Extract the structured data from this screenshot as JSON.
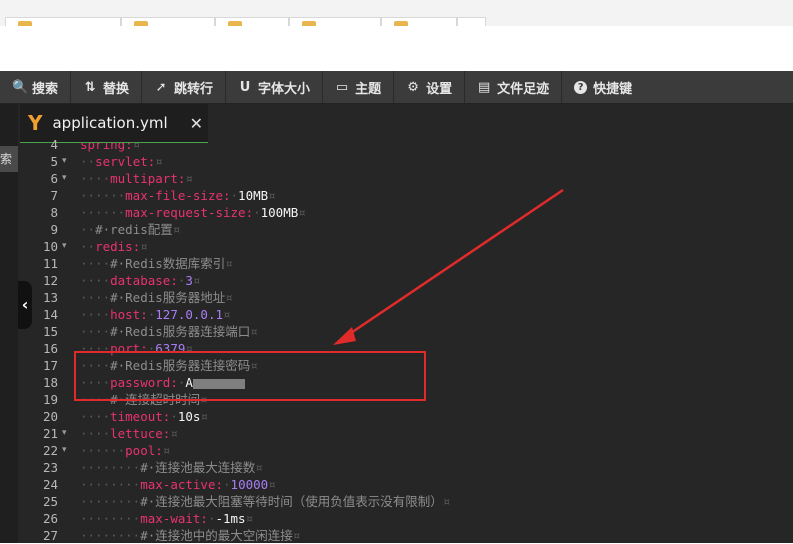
{
  "toolbar": {
    "items": [
      {
        "icon": "search-icon",
        "glyph": "🔍",
        "label": "搜索"
      },
      {
        "icon": "replace-icon",
        "glyph": "⇅",
        "label": "替换"
      },
      {
        "icon": "goto-line-icon",
        "glyph": "➚",
        "label": "跳转行"
      },
      {
        "icon": "font-size-icon",
        "glyph": "U",
        "label": "字体大小"
      },
      {
        "icon": "theme-icon",
        "glyph": "▭",
        "label": "主题"
      },
      {
        "icon": "settings-icon",
        "glyph": "⚙",
        "label": "设置"
      },
      {
        "icon": "history-icon",
        "glyph": "▤",
        "label": "文件足迹"
      },
      {
        "icon": "help-icon",
        "glyph": "?",
        "label": "快捷键"
      }
    ]
  },
  "sidebar": {
    "search_tab_label": "索"
  },
  "editor": {
    "file_tab": {
      "logo": "Y",
      "name": "application.yml",
      "close": "✕"
    },
    "collapse_glyph": "‹",
    "lines": [
      {
        "n": "4",
        "fold": false,
        "text": "spring:¤"
      },
      {
        "n": "5",
        "fold": true,
        "text": "··servlet:¤"
      },
      {
        "n": "6",
        "fold": true,
        "text": "····multipart:¤"
      },
      {
        "n": "7",
        "fold": false,
        "text": "······max-file-size:·10MB¤"
      },
      {
        "n": "8",
        "fold": false,
        "text": "······max-request-size:·100MB¤"
      },
      {
        "n": "9",
        "fold": false,
        "text": "··#·redis配置¤"
      },
      {
        "n": "10",
        "fold": true,
        "text": "··redis:¤"
      },
      {
        "n": "11",
        "fold": false,
        "text": "····#·Redis数据库索引¤"
      },
      {
        "n": "12",
        "fold": false,
        "text": "····database:·3¤"
      },
      {
        "n": "13",
        "fold": false,
        "text": "····#·Redis服务器地址¤"
      },
      {
        "n": "14",
        "fold": false,
        "text": "····host:·127.0.0.1¤"
      },
      {
        "n": "15",
        "fold": false,
        "text": "····#·Redis服务器连接端口¤"
      },
      {
        "n": "16",
        "fold": false,
        "text": "····port:·6379¤"
      },
      {
        "n": "17",
        "fold": false,
        "text": "····#·Redis服务器连接密码¤"
      },
      {
        "n": "18",
        "fold": false,
        "text": "····password:·A"
      },
      {
        "n": "19",
        "fold": false,
        "text": "····#·连接超时时间¤"
      },
      {
        "n": "20",
        "fold": false,
        "text": "····timeout:·10s¤"
      },
      {
        "n": "21",
        "fold": true,
        "text": "····lettuce:¤"
      },
      {
        "n": "22",
        "fold": true,
        "text": "······pool:¤"
      },
      {
        "n": "23",
        "fold": false,
        "text": "········#·连接池最大连接数¤"
      },
      {
        "n": "24",
        "fold": false,
        "text": "········max-active:·10000¤"
      },
      {
        "n": "25",
        "fold": false,
        "text": "········#·连接池最大阻塞等待时间（使用负值表示没有限制）¤"
      },
      {
        "n": "26",
        "fold": false,
        "text": "········max-wait:·-1ms¤"
      },
      {
        "n": "27",
        "fold": false,
        "text": "········#·连接池中的最大空闲连接¤"
      }
    ]
  },
  "colors": {
    "key": "#e8336f",
    "number": "#a97ef5",
    "comment": "#8d8d8d",
    "annotation": "#e12b2b",
    "tab_underline": "#4aa54a"
  }
}
